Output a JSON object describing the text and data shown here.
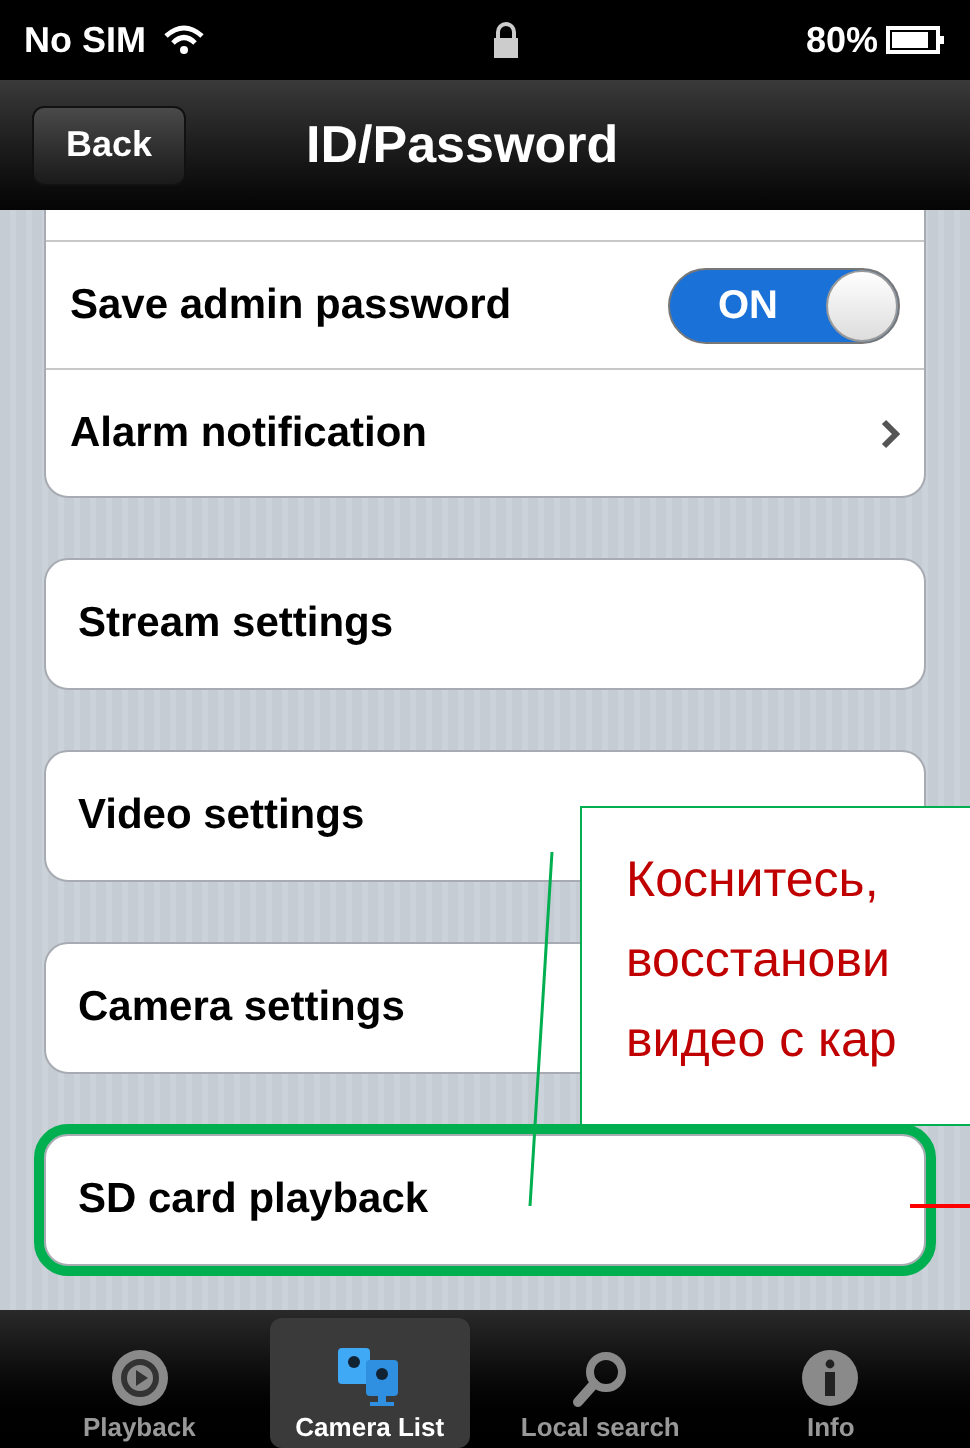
{
  "status_bar": {
    "carrier": "No SIM",
    "battery": "80%"
  },
  "nav_bar": {
    "back": "Back",
    "title": "ID/Password"
  },
  "groups": [
    {
      "rows": [
        {
          "kind": "blank",
          "label": ""
        },
        {
          "kind": "toggle",
          "label": "Save admin password",
          "on": true,
          "toggle_text": "ON"
        },
        {
          "kind": "chevron",
          "label": "Alarm notification"
        }
      ]
    },
    {
      "rows": [
        {
          "kind": "plain",
          "label": "Stream settings"
        }
      ]
    },
    {
      "rows": [
        {
          "kind": "plain",
          "label": "Video settings"
        }
      ]
    },
    {
      "rows": [
        {
          "kind": "plain",
          "label": "Camera settings"
        }
      ]
    },
    {
      "rows": [
        {
          "kind": "plain",
          "label": "SD card playback",
          "highlighted": true
        }
      ]
    }
  ],
  "callout": {
    "lines": [
      "Коснитесь,",
      "восстанови",
      "видео с кар"
    ]
  },
  "tabs": [
    {
      "label": "Playback",
      "selected": false,
      "kind": "playback"
    },
    {
      "label": "Camera List",
      "selected": true,
      "kind": "cameras"
    },
    {
      "label": "Local search",
      "selected": false,
      "kind": "search"
    },
    {
      "label": "Info",
      "selected": false,
      "kind": "info"
    }
  ]
}
